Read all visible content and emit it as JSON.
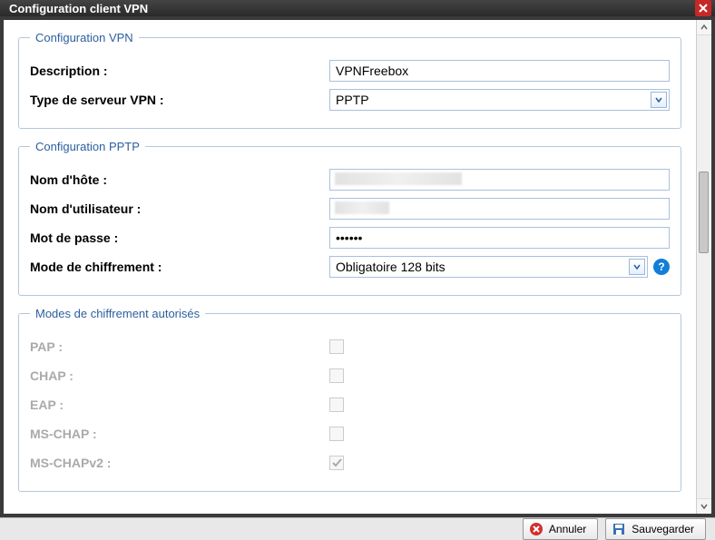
{
  "window": {
    "title": "Configuration client VPN"
  },
  "group_vpn": {
    "legend": "Configuration VPN",
    "description_label": "Description :",
    "description_value": "VPNFreebox",
    "server_type_label": "Type de serveur VPN :",
    "server_type_value": "PPTP"
  },
  "group_pptp": {
    "legend": "Configuration PPTP",
    "host_label": "Nom d'hôte :",
    "host_value": "",
    "user_label": "Nom d'utilisateur :",
    "user_value": "",
    "password_label": "Mot de passe :",
    "password_value": "••••••",
    "enc_mode_label": "Mode de chiffrement :",
    "enc_mode_value": "Obligatoire 128 bits",
    "help_tooltip": "?"
  },
  "group_modes": {
    "legend": "Modes de chiffrement autorisés",
    "pap_label": "PAP :",
    "pap_checked": false,
    "chap_label": "CHAP :",
    "chap_checked": false,
    "eap_label": "EAP :",
    "eap_checked": false,
    "mschap_label": "MS-CHAP :",
    "mschap_checked": false,
    "mschapv2_label": "MS-CHAPv2 :",
    "mschapv2_checked": true
  },
  "footer": {
    "cancel_label": "Annuler",
    "save_label": "Sauvegarder"
  }
}
